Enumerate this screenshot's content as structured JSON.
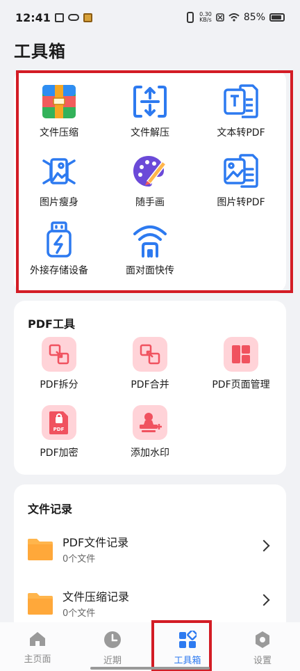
{
  "status_bar": {
    "time": "12:41",
    "speed_value": "0.30",
    "speed_unit": "KB/s",
    "battery": "85%"
  },
  "page": {
    "title": "工具箱"
  },
  "tools": [
    {
      "label": "文件压缩",
      "icon": "archive-icon"
    },
    {
      "label": "文件解压",
      "icon": "unzip-icon"
    },
    {
      "label": "文本转PDF",
      "icon": "text-to-pdf-icon"
    },
    {
      "label": "图片瘦身",
      "icon": "image-compress-icon"
    },
    {
      "label": "随手画",
      "icon": "palette-icon"
    },
    {
      "label": "图片转PDF",
      "icon": "image-to-pdf-icon"
    },
    {
      "label": "外接存储设备",
      "icon": "usb-icon"
    },
    {
      "label": "面对面快传",
      "icon": "wifi-share-icon"
    }
  ],
  "pdf_tools": {
    "title": "PDF工具",
    "items": [
      {
        "label": "PDF拆分",
        "icon": "pdf-split-icon"
      },
      {
        "label": "PDF合并",
        "icon": "pdf-merge-icon"
      },
      {
        "label": "PDF页面管理",
        "icon": "pdf-page-manage-icon"
      },
      {
        "label": "PDF加密",
        "icon": "pdf-lock-icon"
      },
      {
        "label": "添加水印",
        "icon": "watermark-stamp-icon"
      }
    ],
    "pdf_badge": "PDF"
  },
  "records": {
    "title": "文件记录",
    "items": [
      {
        "title": "PDF文件记录",
        "count": "0个文件"
      },
      {
        "title": "文件压缩记录",
        "count": "0个文件"
      }
    ]
  },
  "nav": [
    {
      "label": "主页面",
      "icon": "home-icon"
    },
    {
      "label": "近期",
      "icon": "clock-icon"
    },
    {
      "label": "工具箱",
      "icon": "toolbox-icon"
    },
    {
      "label": "设置",
      "icon": "settings-icon"
    }
  ],
  "colors": {
    "primary_blue": "#2d7af0",
    "highlight_red": "#d31c25",
    "pink_tile": "#ffd3d8",
    "pdf_red": "#f0525f",
    "folder_orange": "#ffb54c"
  }
}
